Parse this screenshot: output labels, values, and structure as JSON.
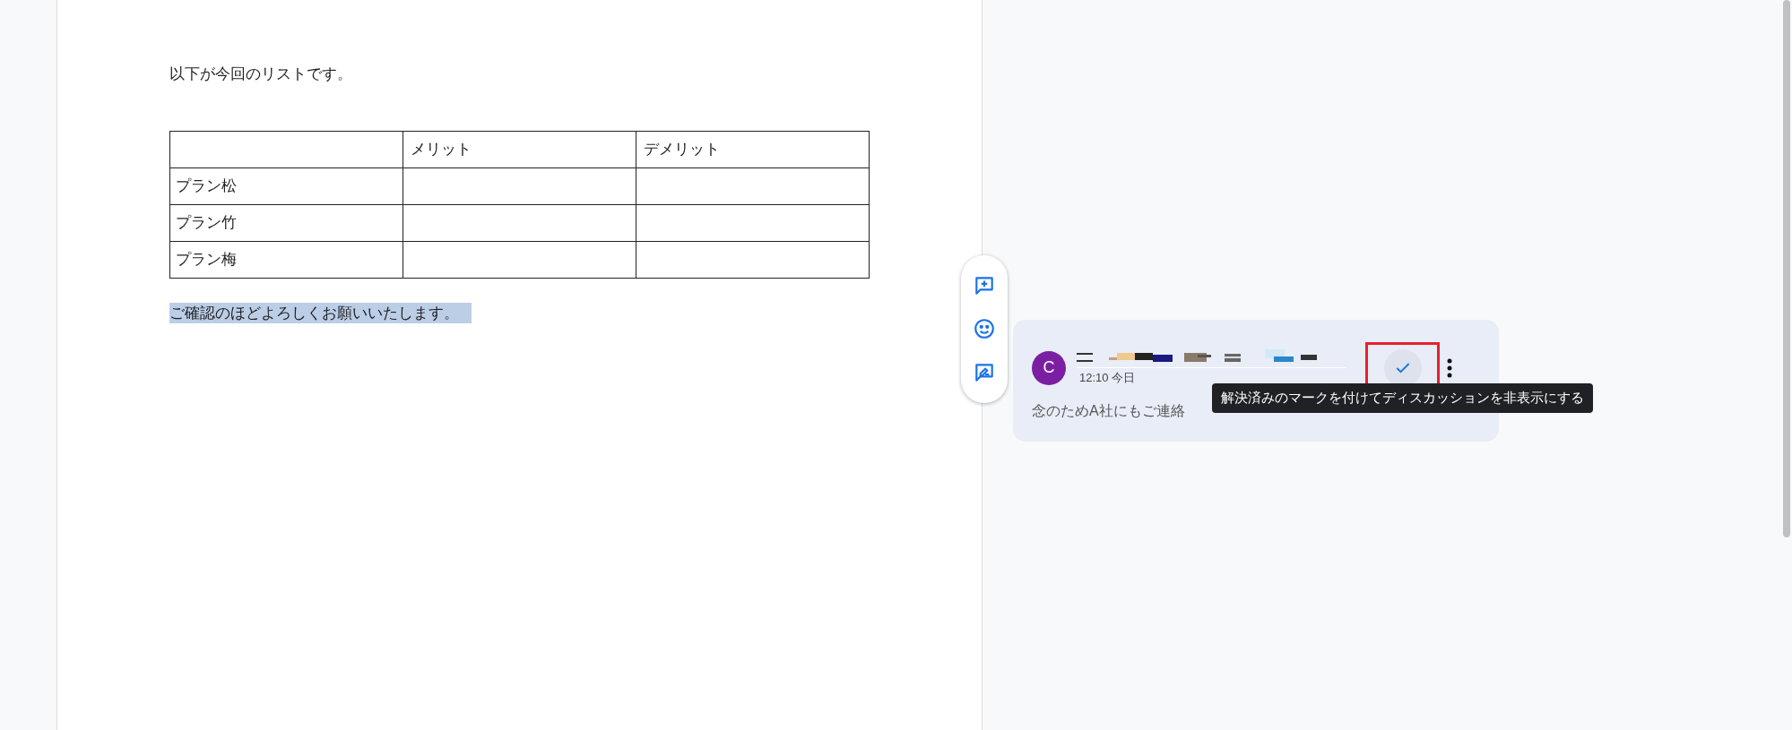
{
  "document": {
    "intro": "以下が今回のリストです。",
    "table": {
      "columns": [
        "",
        "メリット",
        "デメリット"
      ],
      "rows": [
        [
          "プラン松",
          "",
          ""
        ],
        [
          "プラン竹",
          "",
          ""
        ],
        [
          "プラン梅",
          "",
          ""
        ]
      ]
    },
    "closing": {
      "text": "ご確認のほどよろしくお願いいたします。",
      "selected": true
    }
  },
  "comment": {
    "avatar_letter": "C",
    "time": "12:10 今日",
    "text": "念のためA社にもご連絡",
    "resolve_highlighted": true,
    "tooltip": "解決済みのマークを付けてディスカッションを非表示にする"
  }
}
